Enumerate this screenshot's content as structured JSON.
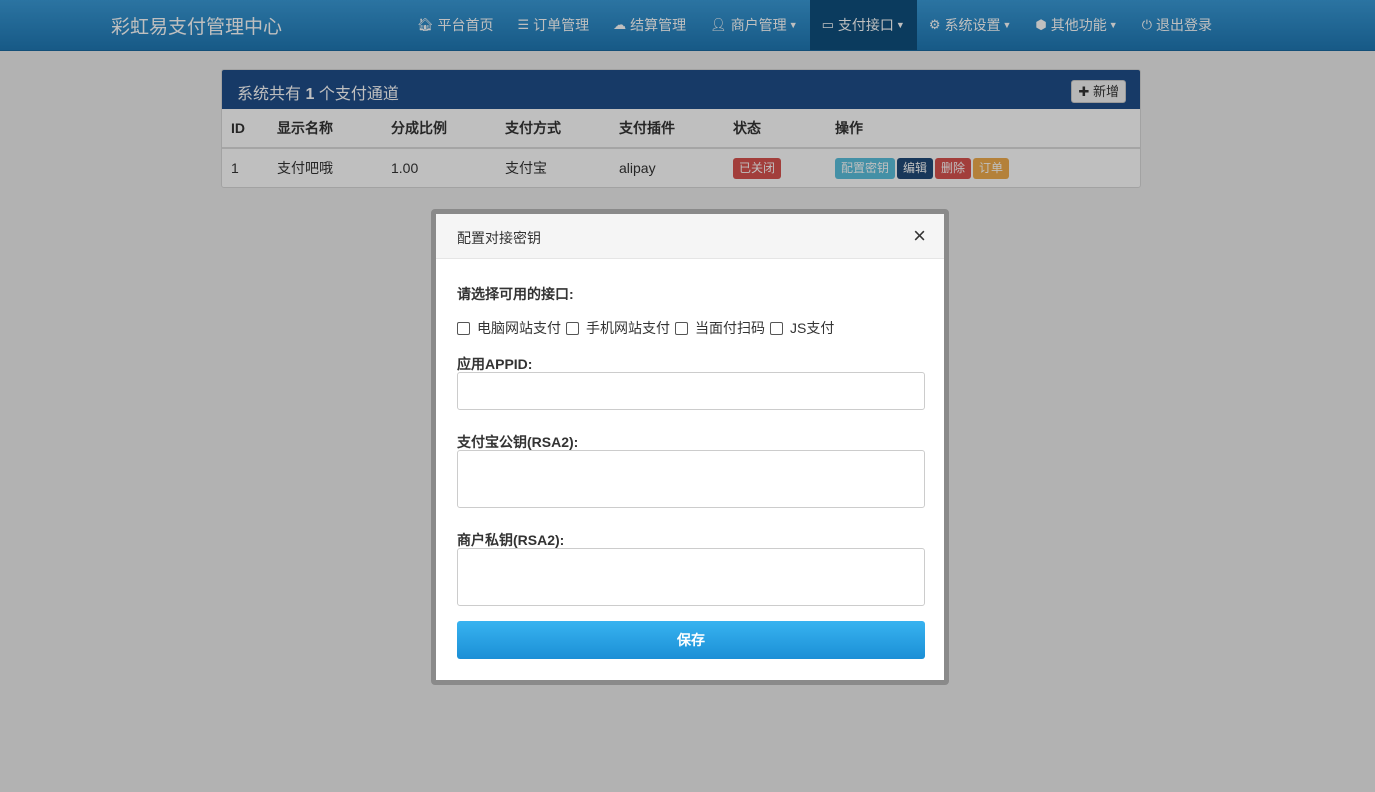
{
  "navbar": {
    "brand": "彩虹易支付管理中心",
    "items": [
      {
        "label": "平台首页",
        "icon": "home-icon"
      },
      {
        "label": "订单管理",
        "icon": "list-icon"
      },
      {
        "label": "结算管理",
        "icon": "cloud-icon"
      },
      {
        "label": "商户管理",
        "icon": "user-icon",
        "dropdown": true
      },
      {
        "label": "支付接口",
        "icon": "card-icon",
        "dropdown": true,
        "active": true
      },
      {
        "label": "系统设置",
        "icon": "gear-icon",
        "dropdown": true
      },
      {
        "label": "其他功能",
        "icon": "cube-icon",
        "dropdown": true
      },
      {
        "label": "退出登录",
        "icon": "power-icon"
      }
    ]
  },
  "panel": {
    "title_prefix": "系统共有",
    "count": "1",
    "title_suffix": "个支付通道",
    "add_label": "新增",
    "columns": [
      "ID",
      "显示名称",
      "分成比例",
      "支付方式",
      "支付插件",
      "状态",
      "操作"
    ],
    "rows": [
      {
        "id": "1",
        "name": "支付吧哦",
        "ratio": "1.00",
        "method": "支付宝",
        "plugin": "alipay",
        "status": "已关闭",
        "actions": [
          "配置密钥",
          "编辑",
          "删除",
          "订单"
        ]
      }
    ]
  },
  "modal": {
    "title": "配置对接密钥",
    "close": "×",
    "interface_label": "请选择可用的接口:",
    "checkboxes": [
      "电脑网站支付",
      "手机网站支付",
      "当面付扫码",
      "JS支付"
    ],
    "appid_label": "应用APPID:",
    "alipay_pubkey_label": "支付宝公钥(RSA2):",
    "merchant_privkey_label": "商户私钥(RSA2):",
    "save_label": "保存"
  }
}
